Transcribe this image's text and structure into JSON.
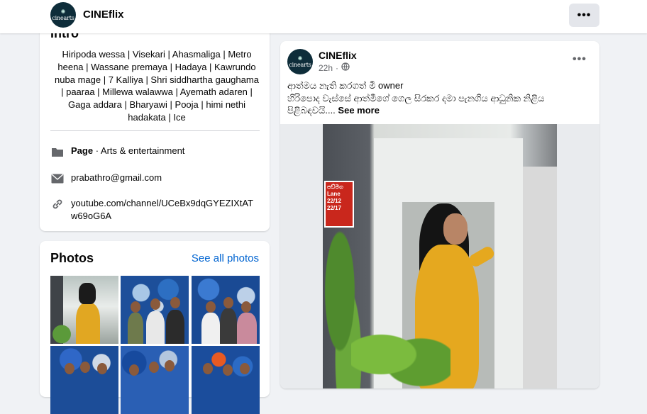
{
  "header": {
    "logo_text": "cinearts",
    "page_name": "CINEflix",
    "more_icon": "more-horizontal-icon"
  },
  "intro": {
    "title": "Intro",
    "bio": "Hiripoda wessa | Visekari | Ahasmaliga | Metro heena | Wassane premaya | Hadaya | Kawrundo nuba mage | 7 Kalliya | Shri siddhartha gaughama | paaraa | Millewa walawwa | Ayemath adaren | Gaga addara | Bharyawi | Pooja | himi nethi hadakata | Ice",
    "category_label": "Page",
    "category_value": " · Arts & entertainment",
    "email": "prabathro@gmail.com",
    "website": "youtube.com/channel/UCeBx9dqGYEZIXtATw69oG6A",
    "icons": [
      "page-icon",
      "mail-icon",
      "link-icon"
    ]
  },
  "photos": {
    "title": "Photos",
    "see_all": "See all photos"
  },
  "post": {
    "author": "CINEflix",
    "time": "22h",
    "audience_icon": "globe-icon",
    "text_line1": "ආත්මය නැති කරගත් මී owner",
    "text_line2": "හිරිපොද වැස්සේ ආත්මීගේ ගෙල සිරකර දමා පැනගිය ආධුනික නිළිය පිළිබඳවයි....",
    "see_more": "See more",
    "sign_text": "පඩ්මග Lane 22/12 22/17"
  },
  "colors": {
    "link": "#0064d1",
    "page_bg": "#f0f2f5",
    "card_bg": "#ffffff",
    "logo_bg": "#0e2d3a"
  }
}
